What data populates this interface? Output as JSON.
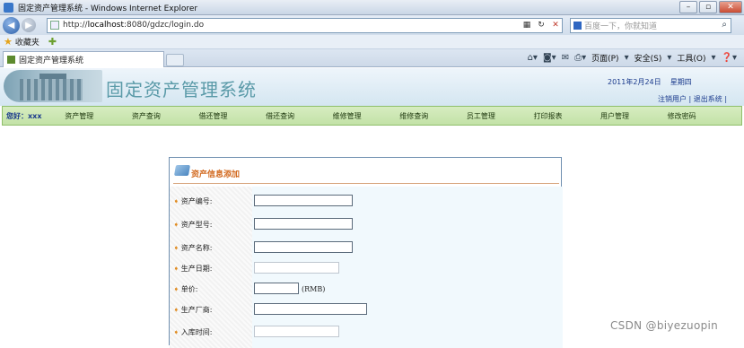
{
  "browser": {
    "window_title": "固定资产管理系统 - Windows Internet Explorer",
    "url_prefix": "http://",
    "url_host": "localhost",
    "url_rest": ":8080/gdzc/login.do",
    "search_placeholder": "百度一下，你就知道",
    "favorites_label": "收藏夹",
    "tab_title": "固定资产管理系统",
    "commands": [
      "页面(P)",
      "安全(S)",
      "工具(O)"
    ]
  },
  "header": {
    "site_title": "固定资产管理系统",
    "date": "2011年2月24日",
    "weekday": "星期四",
    "logout_user": "注销用户",
    "separator": "|",
    "exit_system": "退出系统",
    "trail_sep": "|"
  },
  "nav": {
    "greeting": "您好：xxx",
    "items": [
      "资产管理",
      "资产查询",
      "借还管理",
      "借还查询",
      "维修管理",
      "维修查询",
      "员工管理",
      "打印报表",
      "用户管理",
      "修改密码"
    ]
  },
  "form": {
    "title": "资产信息添加",
    "fields": [
      {
        "label": "资产编号:",
        "value": ""
      },
      {
        "label": "资产型号:",
        "value": ""
      },
      {
        "label": "资产名称:",
        "value": ""
      },
      {
        "label": "生产日期:",
        "value": ""
      },
      {
        "label": "单价:",
        "value": "",
        "unit": "(RMB)"
      },
      {
        "label": "生产厂商:",
        "value": ""
      },
      {
        "label": "入库时间:",
        "value": ""
      }
    ]
  },
  "watermark": "CSDN @biyezuopin"
}
